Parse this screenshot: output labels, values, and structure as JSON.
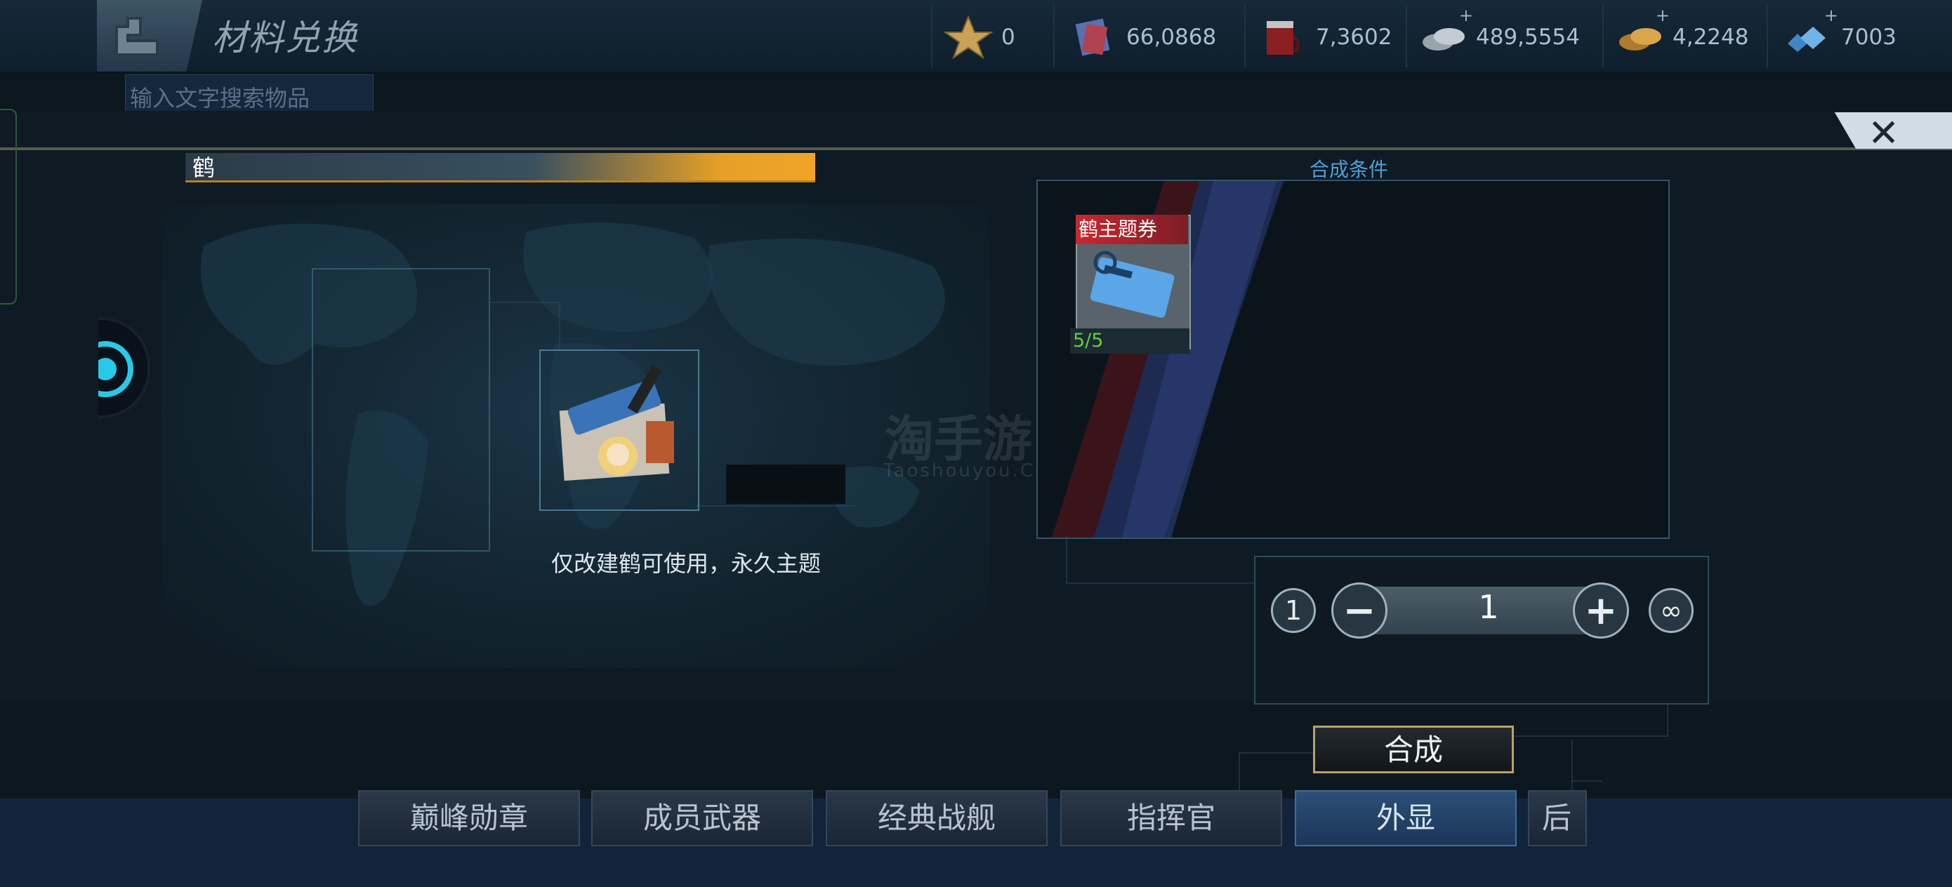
{
  "header": {
    "title": "材料兑换",
    "resources": [
      {
        "icon": "star-medal-icon",
        "value": "0",
        "has_plus": false
      },
      {
        "icon": "blueprint-crystal-icon",
        "value": "66,0868",
        "has_plus": false
      },
      {
        "icon": "paint-bucket-icon",
        "value": "7,3602",
        "has_plus": false
      },
      {
        "icon": "silver-coins-icon",
        "value": "489,5554",
        "has_plus": true
      },
      {
        "icon": "gold-coins-icon",
        "value": "4,2248",
        "has_plus": true
      },
      {
        "icon": "blue-gems-icon",
        "value": "7003",
        "has_plus": true
      }
    ]
  },
  "search": {
    "placeholder": "输入文字搜索物品"
  },
  "item": {
    "name": "鹤",
    "description": "仅改建鹤可使用，永久主题"
  },
  "conditions": {
    "title": "合成条件",
    "requirements": [
      {
        "label": "鹤主题券",
        "count": "5/5"
      }
    ]
  },
  "quantity": {
    "min_label": "1",
    "value": "1",
    "max_symbol": "∞",
    "minus": "−",
    "plus": "+"
  },
  "actions": {
    "synthesize": "合成"
  },
  "tabs": [
    {
      "label": "巅峰勋章",
      "active": false
    },
    {
      "label": "成员武器",
      "active": false
    },
    {
      "label": "经典战舰",
      "active": false
    },
    {
      "label": "指挥官",
      "active": false
    },
    {
      "label": "外显",
      "active": true
    },
    {
      "label": "后",
      "active": false
    }
  ],
  "watermark": {
    "cn": "淘手游",
    "en": "Taoshouyou.Com"
  }
}
